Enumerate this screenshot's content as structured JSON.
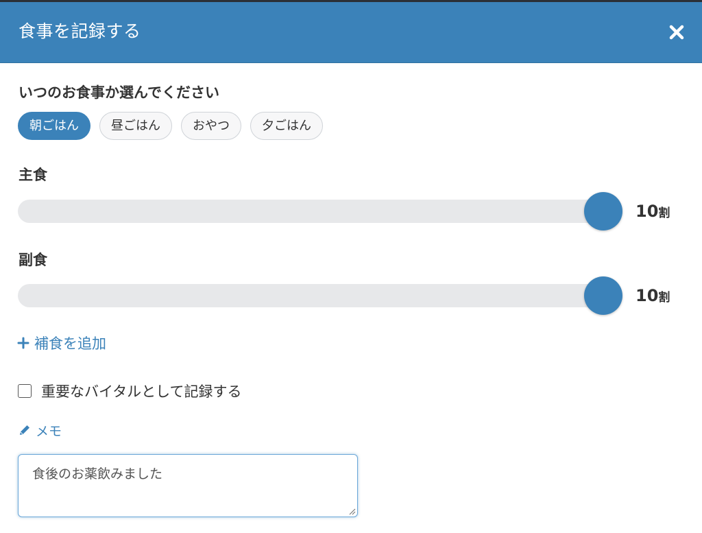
{
  "header": {
    "title": "食事を記録する",
    "close_label": "×"
  },
  "meal_type": {
    "label": "いつのお食事か選んでください",
    "options": [
      {
        "label": "朝ごはん",
        "selected": true
      },
      {
        "label": "昼ごはん",
        "selected": false
      },
      {
        "label": "おやつ",
        "selected": false
      },
      {
        "label": "夕ごはん",
        "selected": false
      }
    ]
  },
  "staple": {
    "label": "主食",
    "value": 10,
    "max": 10,
    "value_text": "10",
    "unit": "割"
  },
  "side": {
    "label": "副食",
    "value": 10,
    "max": 10,
    "value_text": "10",
    "unit": "割"
  },
  "add_supplement_label": "補食を追加",
  "vital": {
    "label": "重要なバイタルとして記録する",
    "checked": false
  },
  "memo": {
    "label": "メモ",
    "value": "食後のお薬飲みました"
  },
  "colors": {
    "accent": "#3b82b9",
    "track": "#e7e8ea"
  },
  "icons": {
    "close": "close-icon",
    "plus": "plus-icon",
    "pencil": "pencil-icon"
  }
}
